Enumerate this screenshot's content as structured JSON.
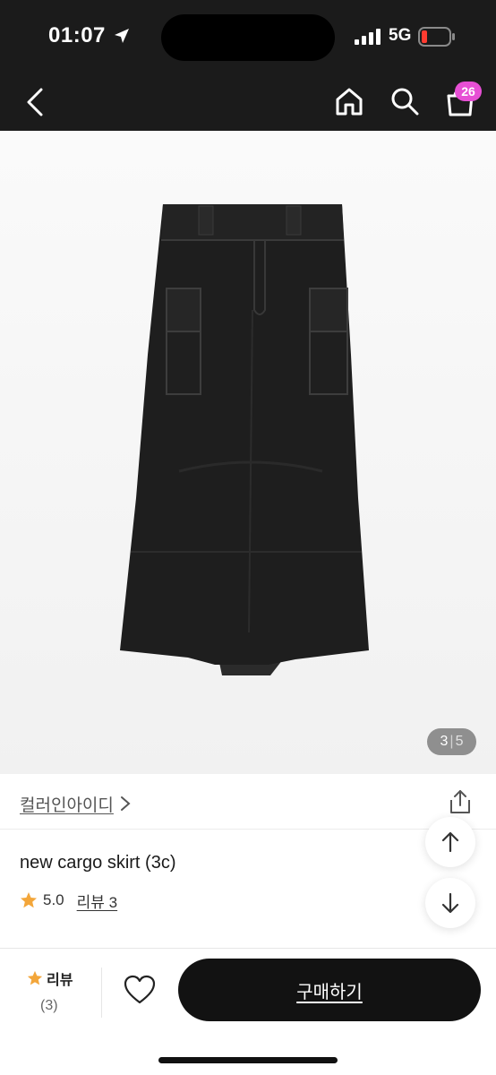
{
  "status": {
    "time": "01:07",
    "network": "5G"
  },
  "header": {
    "cart_count": "26"
  },
  "gallery": {
    "current": "3",
    "separator": "|",
    "total": "5"
  },
  "brand": {
    "name": "컬러인아이디"
  },
  "product": {
    "name": "new cargo skirt (3c)",
    "rating": "5.0",
    "review_link": "리뷰 3"
  },
  "bottom": {
    "review_label": "리뷰",
    "review_count": "(3)",
    "buy_label": "구매하기"
  },
  "colors": {
    "accent_badge": "#e64fd4",
    "star": "#f3a63a",
    "button": "#121212"
  }
}
